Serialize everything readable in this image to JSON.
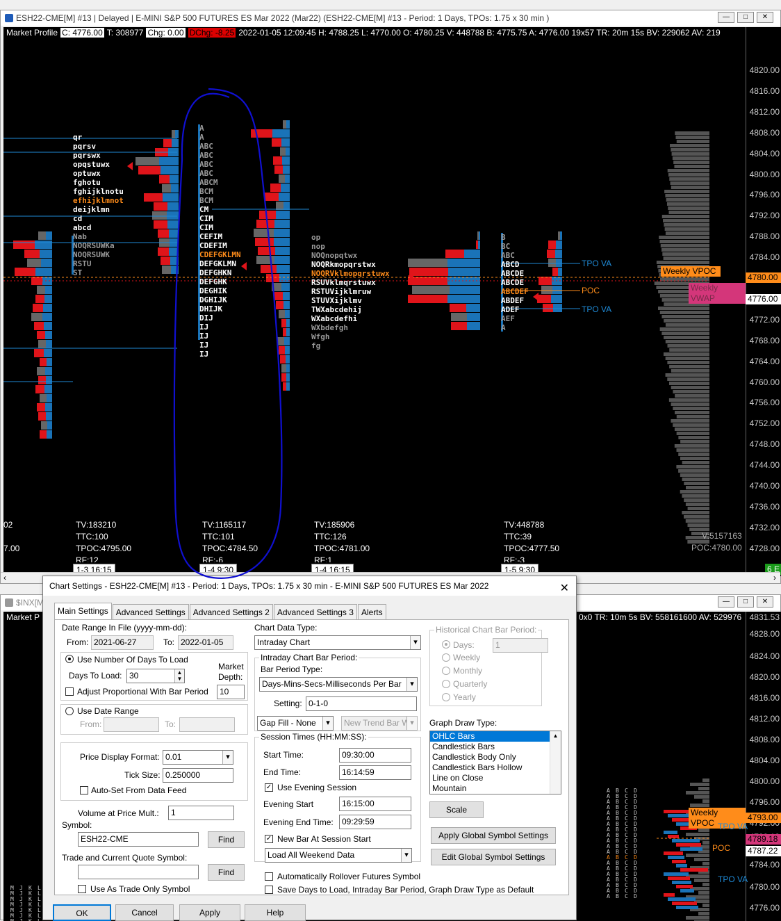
{
  "top_window": {
    "title": "ESH22-CME[M]  #13 | Delayed | E-MINI S&P 500 FUTURES ES Mar 2022 (Mar22) (ESH22-CME[M]  #13 - Period: 1 Days, TPOs: 1.75 x 30 min  )",
    "header": {
      "study": "Market Profile",
      "c": "C: 4776.00",
      "t": "T: 308977",
      "chg": "Chg: 0.00",
      "dchg": "DChg: -8.25",
      "rest": "2022-01-05 12:09:45 H: 4788.25 L: 4770.00 O: 4780.25 V: 448788 B: 4775.75 A: 4776.00 19x57 TR: 20m 15s BV: 229062 AV: 219"
    },
    "price_axis": [
      "4820.00",
      "4816.00",
      "4812.00",
      "4808.00",
      "4804.00",
      "4800.00",
      "4796.00",
      "4792.00",
      "4788.00",
      "4784.00",
      "4780.00",
      "4776.00",
      "4772.00",
      "4768.00",
      "4764.00",
      "4760.00",
      "4756.00",
      "4752.00",
      "4748.00",
      "4744.00",
      "4740.00",
      "4736.00",
      "4732.00",
      "4728.00"
    ],
    "tags": {
      "weekly_vpoc": "Weekly VPOC",
      "weekly_vpoc_price": "4780.00",
      "weekly_vwap": "Weekly VWAP",
      "last_price": "4776.00",
      "tpo_va_top": "TPO VA",
      "poc": "POC",
      "tpo_va_bottom": "TPO VA"
    },
    "profiles": [
      {
        "letters": [
          "qr",
          "pqrsv",
          "pqrswx",
          "opqstuwx",
          "optuwx",
          "fghotu",
          "fghijklnotu",
          "efhijklmnot",
          "deijklmn",
          "cd",
          "abcd",
          "Nab",
          "NOQRSUWKa",
          "NOQRSUWK",
          "RSTU",
          "ST"
        ],
        "stats": "TV:183210\nTTC:100\nTPOC:4795.00\nRF:12",
        "date": "1-3  16:15"
      },
      {
        "letters": [
          "A",
          "A",
          "ABC",
          "ABC",
          "ABC",
          "ABC",
          "ABCM",
          "BCM",
          "BCM",
          "CM",
          "CIM",
          "CIM",
          "CEFIM",
          "CDEFIM",
          "CDEFGKLMN",
          "DEFGKLMN",
          "DEFGHKN",
          "DEFGHK",
          "DEGHIK",
          "DGHIJK",
          "DHIJK",
          "DIJ",
          "IJ",
          "IJ",
          "IJ",
          "IJ"
        ],
        "stats": "TV:1165117\nTTC:101\nTPOC:4784.50\nRF:-6",
        "date": "1-4  9:30"
      },
      {
        "letters": [
          "op",
          "nop",
          "NOQnopqtwx",
          "NOQRkmopqrstwx",
          "NOQRVklmopqrstuwx",
          "RSUVklmqrstuwx",
          "RSTUVijklmruw",
          "STUVXijklmv",
          "TWXabcdehij",
          "WXabcdefhi",
          "WXbdefgh",
          "Wfgh",
          "fg"
        ],
        "stats": "TV:185906\nTTC:126\nTPOC:4781.00\nRF:1",
        "date": "1-4  16:15"
      },
      {
        "letters": [
          "B",
          "BC",
          "ABC",
          "ABCD",
          "ABCDE",
          "ABCDE",
          "ABCDEF",
          "ABDEF",
          "ADEF",
          "AEF",
          "A"
        ],
        "stats": "TV:448788\nTTC:39\nTPOC:4777.50\nRF:-3",
        "date": "1-5  9:30"
      }
    ],
    "left_stats": "02\n\n7.00",
    "right_stats": "V:5157163\nPOC:4780.00",
    "badge": "6 E"
  },
  "bottom_window": {
    "title": "$INX[M]",
    "header_left": "Market P",
    "header_right": "0x0 TR: 10m 5s BV: 558161600 AV: 529976",
    "price_axis": [
      "4831.53",
      "4828.00",
      "4824.00",
      "4820.00",
      "4816.00",
      "4812.00",
      "4808.00",
      "4804.00",
      "4800.00",
      "4796.00",
      "4792.00",
      "4789.18",
      "4787.22",
      "4784.00",
      "4780.00",
      "4776.00"
    ],
    "tags": {
      "weekly_vpoc": "Weekly VPOC",
      "vpoc_price": "4793.00",
      "tpo_va": "TPO VA",
      "poc": "POC",
      "tpo_va2": "TPO VA",
      "price_a": "4789.18",
      "price_b": "4787.22"
    }
  },
  "dialog": {
    "title": "Chart Settings - ESH22-CME[M]  #13 - Period: 1 Days, TPOs: 1.75 x 30 min   - E-MINI S&P 500 FUTURES ES Mar 2022",
    "tabs": [
      "Main Settings",
      "Advanced Settings",
      "Advanced Settings 2",
      "Advanced Settings 3",
      "Alerts"
    ],
    "date_range_label": "Date Range In File (yyyy-mm-dd):",
    "from_label": "From:",
    "from_value": "2021-06-27",
    "to_label": "To:",
    "to_value": "2022-01-05",
    "use_days_label": "Use Number Of Days To Load",
    "days_to_load_label": "Days To Load:",
    "days_to_load_value": "30",
    "market_depth_label": "Market Depth:",
    "market_depth_value": "10",
    "adjust_label": "Adjust Proportional With Bar Period",
    "use_date_range_label": "Use Date Range",
    "dr_from_label": "From:",
    "dr_to_label": "To:",
    "price_format_label": "Price Display Format:",
    "price_format_value": "0.01",
    "tick_size_label": "Tick Size:",
    "tick_size_value": "0.250000",
    "auto_set_label": "Auto-Set From Data Feed",
    "volume_mult_label": "Volume at Price Mult.:",
    "volume_mult_value": "1",
    "symbol_label": "Symbol:",
    "symbol_value": "ESH22-CME",
    "find_label": "Find",
    "trade_quote_label": "Trade and Current Quote Symbol:",
    "trade_quote_value": "",
    "find2_label": "Find",
    "use_trade_only_label": "Use As Trade Only Symbol",
    "chart_data_type_label": "Chart Data Type:",
    "chart_data_type_value": "Intraday Chart",
    "intraday_period_label": "Intraday Chart Bar Period:",
    "bar_period_type_label": "Bar Period Type:",
    "bar_period_type_value": "Days-Mins-Secs-Milliseconds Per Bar",
    "setting_label": "Setting:",
    "setting_value": "0-1-0",
    "gap_fill_value": "Gap Fill - None",
    "new_trend_value": "New Trend Bar W",
    "session_times_label": "Session Times (HH:MM:SS):",
    "start_time_label": "Start Time:",
    "start_time_value": "09:30:00",
    "end_time_label": "End Time:",
    "end_time_value": "16:14:59",
    "use_evening_label": "Use Evening Session",
    "evening_start_label": "Evening Start",
    "evening_start_value": "16:15:00",
    "evening_end_label": "Evening End Time:",
    "evening_end_value": "09:29:59",
    "new_bar_label": "New Bar At Session Start",
    "weekend_value": "Load All Weekend Data",
    "historical_label": "Historical Chart Bar Period:",
    "hist_options": [
      "Days:",
      "Weekly",
      "Monthly",
      "Quarterly",
      "Yearly"
    ],
    "hist_days_value": "1",
    "graph_draw_label": "Graph Draw Type:",
    "graph_draw_options": [
      "OHLC Bars",
      "Candlestick Bars",
      "Candlestick Body Only",
      "Candlestick Bars Hollow",
      "Line on Close",
      "Mountain"
    ],
    "scale_label": "Scale",
    "apply_global_label": "Apply Global Symbol Settings",
    "edit_global_label": "Edit Global Symbol Settings",
    "auto_rollover_label": "Automatically Rollover Futures Symbol",
    "save_days_label": "Save Days to Load, Intraday Bar Period, Graph Draw Type as Default",
    "ok_label": "OK",
    "cancel_label": "Cancel",
    "apply_label": "Apply",
    "help_label": "Help"
  },
  "colors": {
    "buy": "#1a73b8",
    "sell": "#e0141a",
    "poc": "#ff8c1a",
    "vwap": "#d4367a",
    "tpo_va": "#1f8ad6"
  }
}
